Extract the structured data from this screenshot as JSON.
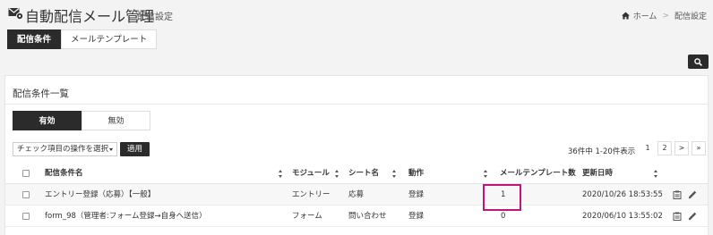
{
  "header": {
    "title": "自動配信メール管理",
    "subtitle": "配信設定",
    "breadcrumb": {
      "home": "ホーム",
      "separator": ">",
      "current": "配信設定"
    }
  },
  "top_tabs": [
    "配信条件",
    "メールテンプレート"
  ],
  "panel": {
    "title": "配信条件一覧",
    "status_tabs": [
      "有効",
      "無効"
    ],
    "bulk_action_placeholder": "チェック項目の操作を選択",
    "apply_label": "適用",
    "pager_info": "36件中 1-20件表示",
    "pages": [
      "1",
      "2",
      ">",
      "»"
    ]
  },
  "table": {
    "columns": [
      "配信条件名",
      "モジュール",
      "シート名",
      "動作",
      "メールテンプレート数",
      "更新日時"
    ],
    "rows": [
      {
        "name": "エントリー登録（応募）【一般】",
        "module": "エントリー",
        "sheet": "応募",
        "action": "登録",
        "template_count": "1",
        "updated": "2020/10/26 18:53:55"
      },
      {
        "name": "form_98（管理者:フォーム登録→自身へ送信）",
        "module": "フォーム",
        "sheet": "問い合わせ",
        "action": "登録",
        "template_count": "0",
        "updated": "2020/06/10 13:55:02"
      }
    ]
  },
  "colors": {
    "dark": "#2b2b2b",
    "highlight": "#c0157b",
    "background": "#f3f3f3"
  },
  "icons": [
    "mail-gear-icon",
    "home-icon",
    "search-icon",
    "clipboard-icon",
    "pencil-icon",
    "checkbox-icon",
    "sort-icon",
    "caret-down-icon"
  ]
}
